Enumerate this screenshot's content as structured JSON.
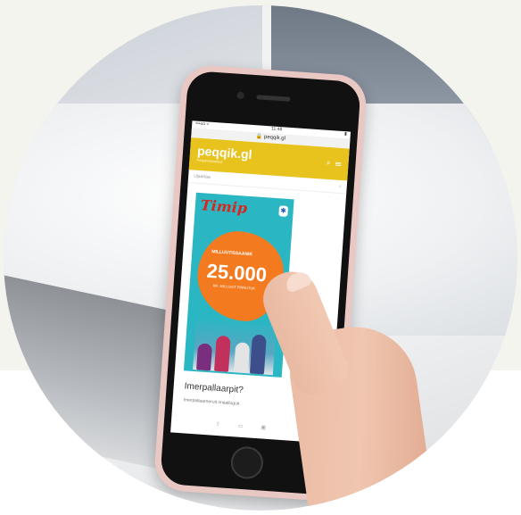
{
  "colors": {
    "site_header": "#e8c21d",
    "ad_background": "#2bb6c4",
    "ad_splash": "#f47a20",
    "ad_brand": "#d8261e",
    "phone_case": "#e9c8c3"
  },
  "phone": {
    "status_left": "•••oo ≈",
    "status_center": "11:48",
    "status_right": "▮",
    "url": "🔒 peqqik.gl"
  },
  "site": {
    "logo": "peqqik.gl",
    "tagline": "Peqqinnissakkut",
    "search_placeholder": "Ujaarlaa",
    "icons": [
      "search-icon",
      "menu-icon"
    ]
  },
  "ad": {
    "brand": "Timip",
    "subtitle": "MILLUUTISSAANIK",
    "number": "25.000",
    "small": "KR. MILLUGIT FINNUTUK"
  },
  "article": {
    "heading": "Imerpallaarpit?",
    "subtext": "Imerpallaarneruit imaalluguit"
  }
}
